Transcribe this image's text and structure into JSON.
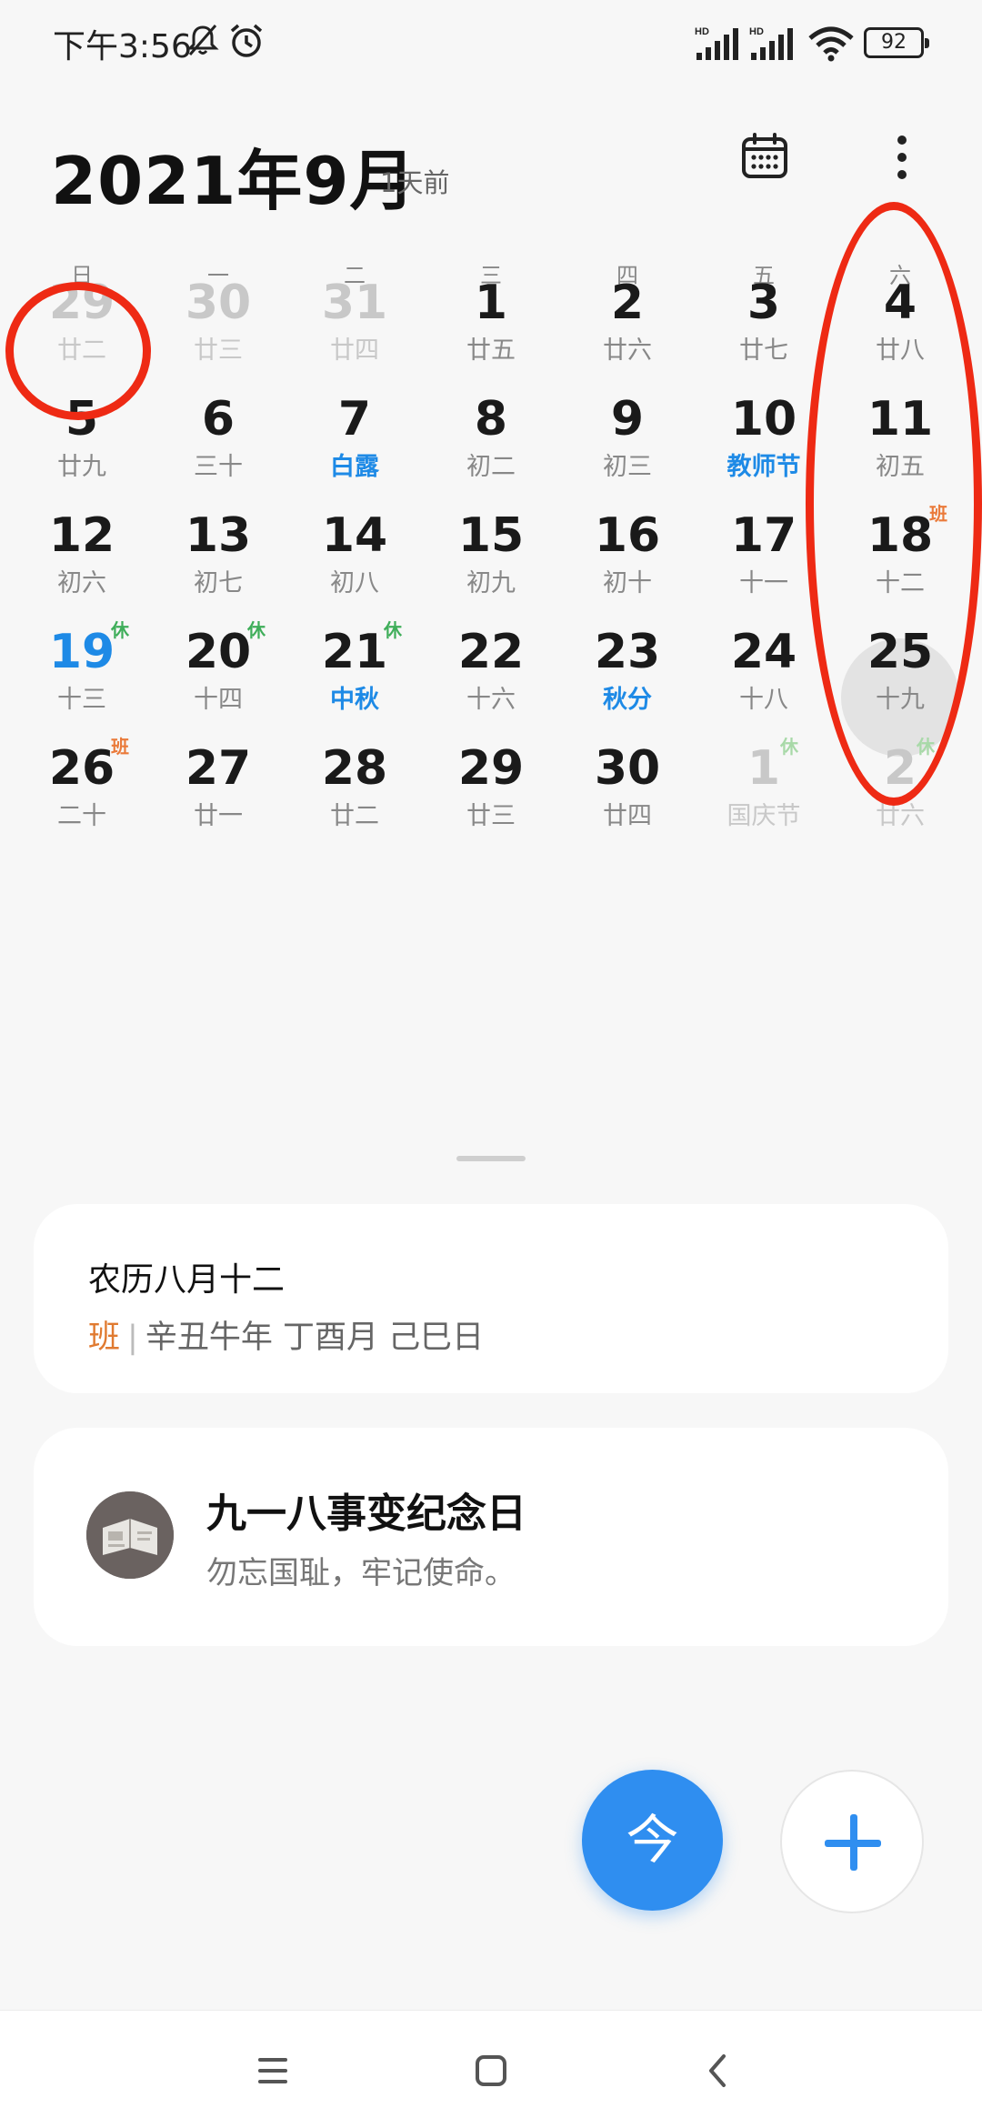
{
  "status_bar": {
    "time": "下午3:56",
    "battery": "92",
    "icons": [
      "mute-bell-icon",
      "alarm-icon",
      "signal-hd-icon",
      "signal-hd-icon",
      "wifi-icon",
      "battery-icon"
    ]
  },
  "header": {
    "month_title": "2021年9月",
    "relative_label": "1天前",
    "icons": [
      "calendar-icon",
      "more-vertical-icon"
    ]
  },
  "weekdays": [
    "日",
    "一",
    "二",
    "三",
    "四",
    "五",
    "六"
  ],
  "days": [
    {
      "n": "29",
      "l": "廿二",
      "dim": true
    },
    {
      "n": "30",
      "l": "廿三",
      "dim": true
    },
    {
      "n": "31",
      "l": "廿四",
      "dim": true
    },
    {
      "n": "1",
      "l": "廿五"
    },
    {
      "n": "2",
      "l": "廿六"
    },
    {
      "n": "3",
      "l": "廿七"
    },
    {
      "n": "4",
      "l": "廿八"
    },
    {
      "n": "5",
      "l": "廿九"
    },
    {
      "n": "6",
      "l": "三十"
    },
    {
      "n": "7",
      "l": "白露",
      "lunar_blue": true
    },
    {
      "n": "8",
      "l": "初二"
    },
    {
      "n": "9",
      "l": "初三"
    },
    {
      "n": "10",
      "l": "教师节",
      "lunar_blue": true
    },
    {
      "n": "11",
      "l": "初五"
    },
    {
      "n": "12",
      "l": "初六"
    },
    {
      "n": "13",
      "l": "初七"
    },
    {
      "n": "14",
      "l": "初八"
    },
    {
      "n": "15",
      "l": "初九"
    },
    {
      "n": "16",
      "l": "初十"
    },
    {
      "n": "17",
      "l": "十一"
    },
    {
      "n": "18",
      "l": "十二",
      "badge": "班",
      "badge_type": "work",
      "selected": true
    },
    {
      "n": "19",
      "l": "十三",
      "badge": "休",
      "badge_type": "rest",
      "num_blue": true
    },
    {
      "n": "20",
      "l": "十四",
      "badge": "休",
      "badge_type": "rest"
    },
    {
      "n": "21",
      "l": "中秋",
      "badge": "休",
      "badge_type": "rest",
      "lunar_blue": true
    },
    {
      "n": "22",
      "l": "十六"
    },
    {
      "n": "23",
      "l": "秋分",
      "lunar_blue": true
    },
    {
      "n": "24",
      "l": "十八"
    },
    {
      "n": "25",
      "l": "十九"
    },
    {
      "n": "26",
      "l": "二十",
      "badge": "班",
      "badge_type": "work"
    },
    {
      "n": "27",
      "l": "廿一"
    },
    {
      "n": "28",
      "l": "廿二"
    },
    {
      "n": "29",
      "l": "廿三"
    },
    {
      "n": "30",
      "l": "廿四"
    },
    {
      "n": "1",
      "l": "国庆节",
      "dim": true,
      "badge": "休",
      "badge_type": "rest"
    },
    {
      "n": "2",
      "l": "廿六",
      "dim": true,
      "badge": "休",
      "badge_type": "rest"
    }
  ],
  "lunar_card": {
    "title": "农历八月十二",
    "work_tag": "班",
    "separator": "|",
    "ganzhi": "辛丑牛年 丁酉月 己巳日"
  },
  "event_card": {
    "title": "九一八事变纪念日",
    "subtitle": "勿忘国耻，牢记使命。"
  },
  "fab": {
    "today_label": "今"
  },
  "nav_bar": {
    "icons": [
      "menu-icon",
      "home-icon",
      "back-icon"
    ]
  },
  "colors": {
    "accent_blue": "#2f8ef0",
    "rest_green": "#3fae5a",
    "work_orange": "#ea7a3a",
    "annotation_red": "#ee2a14"
  }
}
